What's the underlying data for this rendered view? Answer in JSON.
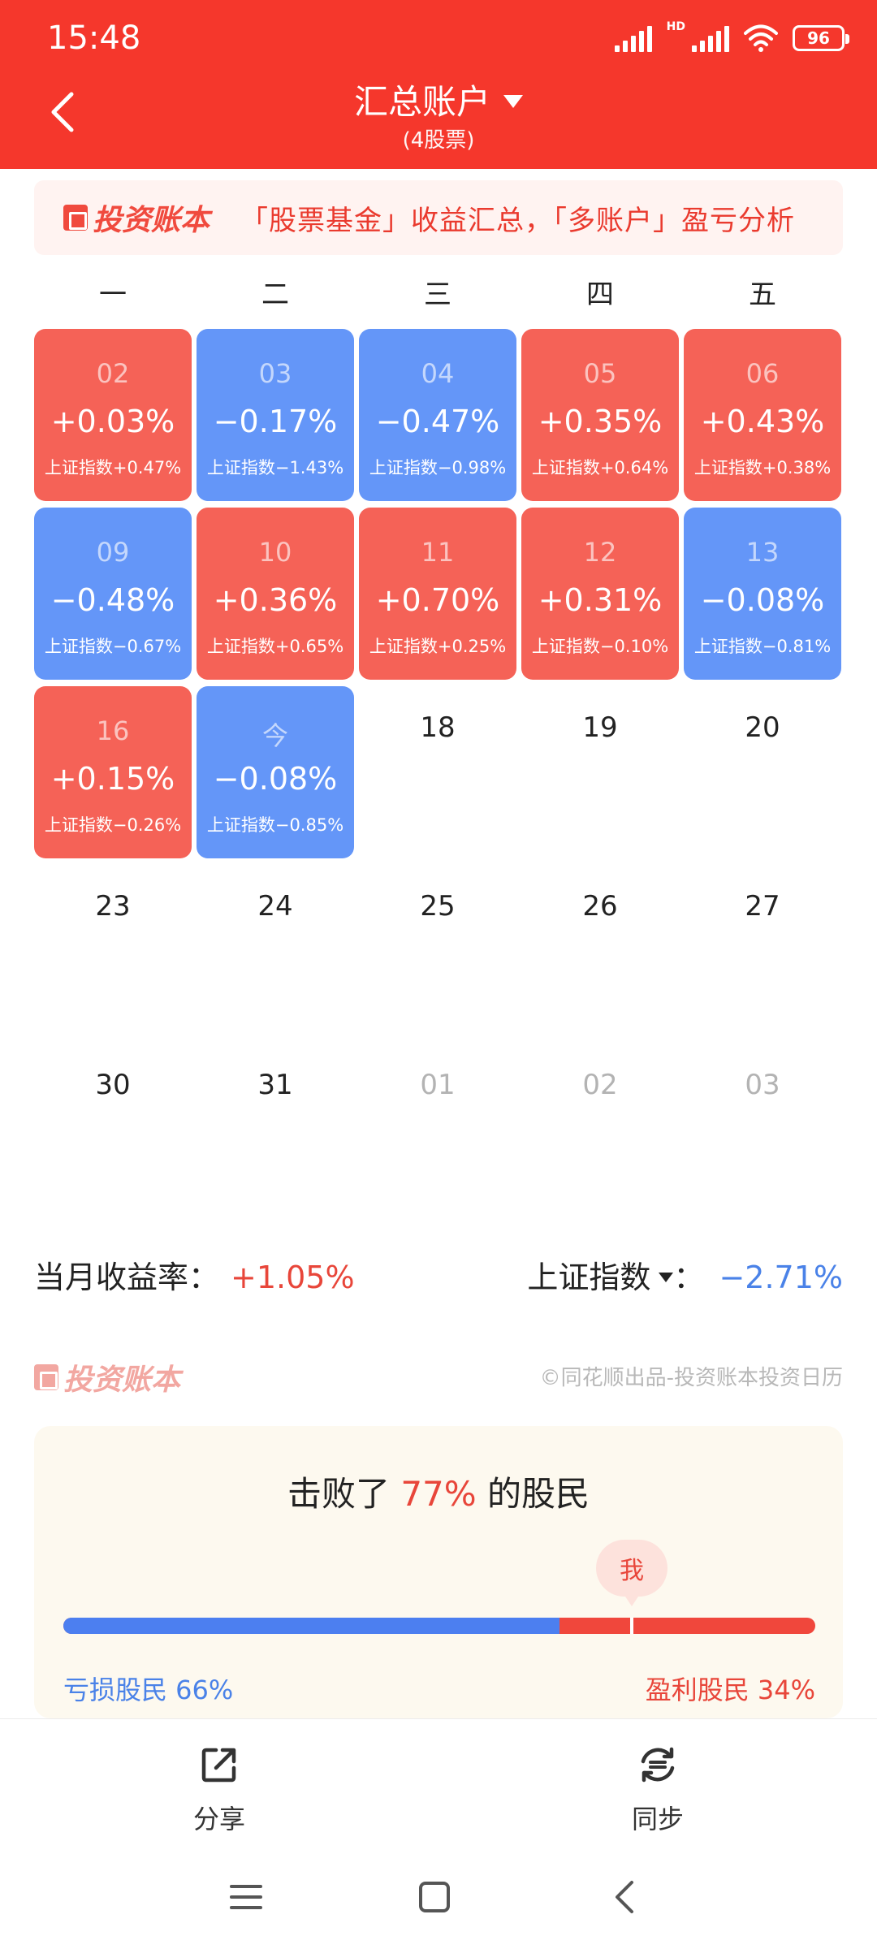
{
  "status_bar": {
    "time": "15:48",
    "network": "HD",
    "battery": "96"
  },
  "header": {
    "title": "汇总账户",
    "subtitle": "(4股票)"
  },
  "banner": {
    "logo": "投资账本",
    "text": "「股票基金」收益汇总，「多账户」盈亏分析"
  },
  "weekdays": [
    "一",
    "二",
    "三",
    "四",
    "五"
  ],
  "calendar": {
    "trading_days": [
      {
        "day": "02",
        "pct": "+0.03%",
        "index": "上证指数+0.47%",
        "trend": "up"
      },
      {
        "day": "03",
        "pct": "−0.17%",
        "index": "上证指数−1.43%",
        "trend": "down"
      },
      {
        "day": "04",
        "pct": "−0.47%",
        "index": "上证指数−0.98%",
        "trend": "down"
      },
      {
        "day": "05",
        "pct": "+0.35%",
        "index": "上证指数+0.64%",
        "trend": "up"
      },
      {
        "day": "06",
        "pct": "+0.43%",
        "index": "上证指数+0.38%",
        "trend": "up"
      },
      {
        "day": "09",
        "pct": "−0.48%",
        "index": "上证指数−0.67%",
        "trend": "down"
      },
      {
        "day": "10",
        "pct": "+0.36%",
        "index": "上证指数+0.65%",
        "trend": "up"
      },
      {
        "day": "11",
        "pct": "+0.70%",
        "index": "上证指数+0.25%",
        "trend": "up"
      },
      {
        "day": "12",
        "pct": "+0.31%",
        "index": "上证指数−0.10%",
        "trend": "up"
      },
      {
        "day": "13",
        "pct": "−0.08%",
        "index": "上证指数−0.81%",
        "trend": "down"
      },
      {
        "day": "16",
        "pct": "+0.15%",
        "index": "上证指数−0.26%",
        "trend": "up"
      },
      {
        "day": "今",
        "pct": "−0.08%",
        "index": "上证指数−0.85%",
        "trend": "down"
      }
    ],
    "future_days": [
      "18",
      "19",
      "20",
      "23",
      "24",
      "25",
      "26",
      "27",
      "30",
      "31"
    ],
    "next_month_days": [
      "01",
      "02",
      "03"
    ]
  },
  "summary": {
    "month_label": "当月收益率：",
    "month_value": "+1.05%",
    "index_label": "上证指数",
    "index_colon": "：",
    "index_value": "−2.71%"
  },
  "footer": {
    "logo": "投资账本",
    "credit": "©同花顺出品-投资账本投资日历"
  },
  "beat": {
    "prefix": "击败了 ",
    "percent": "77%",
    "suffix": " 的股民",
    "me": "我",
    "loss_label": "亏损股民 66%",
    "win_label": "盈利股民 34%",
    "loss_fraction": 0.66
  },
  "toolbar": {
    "share": "分享",
    "sync": "同步"
  },
  "colors": {
    "header": "#f5372c",
    "up": "#f56257",
    "down": "#6496f8"
  }
}
